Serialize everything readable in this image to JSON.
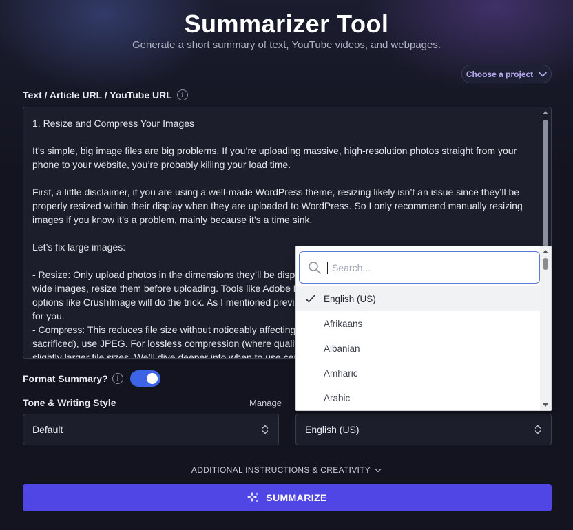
{
  "header": {
    "title": "Summarizer Tool",
    "subtitle": "Generate a short summary of text, YouTube videos, and webpages."
  },
  "project": {
    "label": "Choose a project"
  },
  "input": {
    "label": "Text / Article URL / YouTube URL",
    "lines": [
      "1. Resize and Compress Your Images",
      "",
      "It’s simple, big image files are big problems. If you’re uploading massive, high-resolution photos straight from your",
      "phone to your website, you’re probably killing your load time.",
      "",
      "First, a little disclaimer, if you are using a well-made WordPress theme, resizing likely isn’t an issue since they’ll be",
      "properly resized within their display when they are uploaded to WordPress. So I only recommend manually resizing",
      "images if you know it’s a problem, mainly because it’s a time sink.",
      "",
      "Let’s fix large images:",
      "",
      "- Resize: Only upload photos in the dimensions they’ll be displ",
      "wide images, resize them before uploading. Tools like Adobe P",
      "options like CrushImage will do the trick. As I mentioned previ",
      "for you.",
      "- Compress: This reduces file size without noticeably affecting",
      "sacrificed), use JPEG. For lossless compression (where quality is",
      "slightly larger file sizes. We’ll dive deeper into when to use cer"
    ]
  },
  "format": {
    "label": "Format Summary?",
    "enabled": true
  },
  "tone": {
    "label": "Tone & Writing Style",
    "manage": "Manage",
    "value": "Default"
  },
  "language": {
    "value": "English (US)",
    "search_placeholder": "Search...",
    "options": [
      "English (US)",
      "Afrikaans",
      "Albanian",
      "Amharic",
      "Arabic"
    ],
    "selected_index": 0
  },
  "advanced": {
    "label": "ADDITIONAL INSTRUCTIONS & CREATIVITY"
  },
  "submit": {
    "label": "SUMMARIZE"
  },
  "colors": {
    "accent": "#4f46e5",
    "toggle": "#3d63e6",
    "project_text": "#b6a8ec"
  }
}
